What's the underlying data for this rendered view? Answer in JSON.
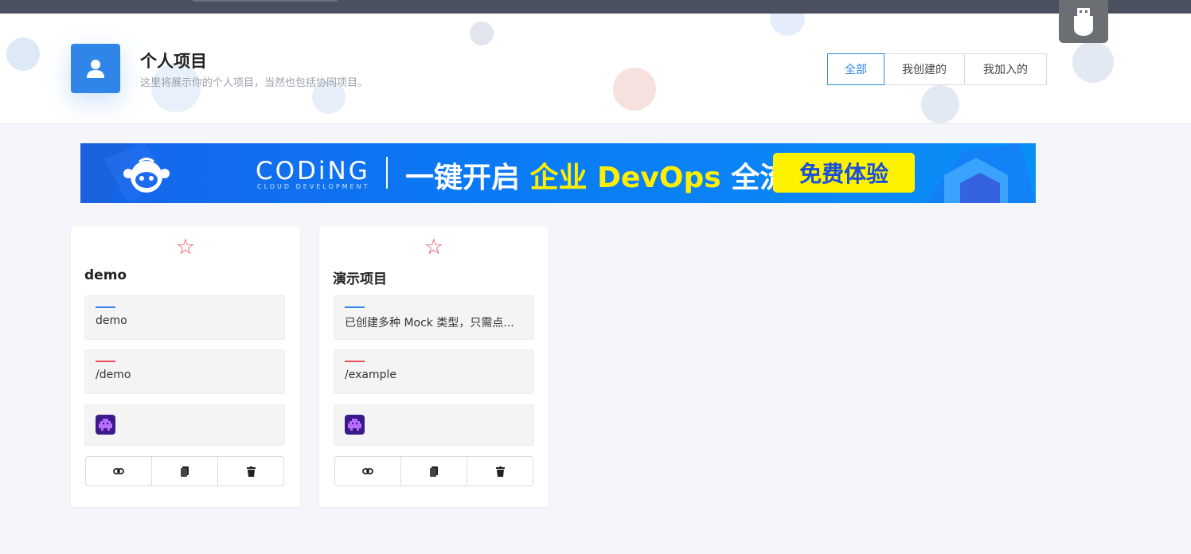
{
  "header": {
    "title": "个人项目",
    "subtitle": "这里将展示你的个人项目，当然也包括协同项目。",
    "filters": [
      {
        "label": "全部",
        "active": true
      },
      {
        "label": "我创建的",
        "active": false
      },
      {
        "label": "我加入的",
        "active": false
      }
    ]
  },
  "banner": {
    "brand": "CODiNG",
    "brand_sub": "CLOUD DEVELOPMENT",
    "headline_part1": "一键开启 ",
    "headline_highlight": "企业 DevOps",
    "headline_part2": " 全流程",
    "cta": "免费体验"
  },
  "projects": [
    {
      "name": "demo",
      "description": "demo",
      "url": "/demo",
      "starred": false
    },
    {
      "name": "演示项目",
      "description": "已创建多种 Mock 类型，只需点...",
      "url": "/example",
      "starred": false
    }
  ],
  "icons": {
    "avatar": "user-icon",
    "star": "star-outline-icon",
    "link": "link-icon",
    "copy": "copy-icon",
    "delete": "trash-icon",
    "owner": "pixel-avatar-icon",
    "usb": "usb-icon"
  },
  "colors": {
    "primary": "#2f86e8",
    "danger": "#ea4e5e",
    "topbar": "#4a5060",
    "banner_highlight": "#ffef00",
    "cta_bg": "#fff200"
  }
}
